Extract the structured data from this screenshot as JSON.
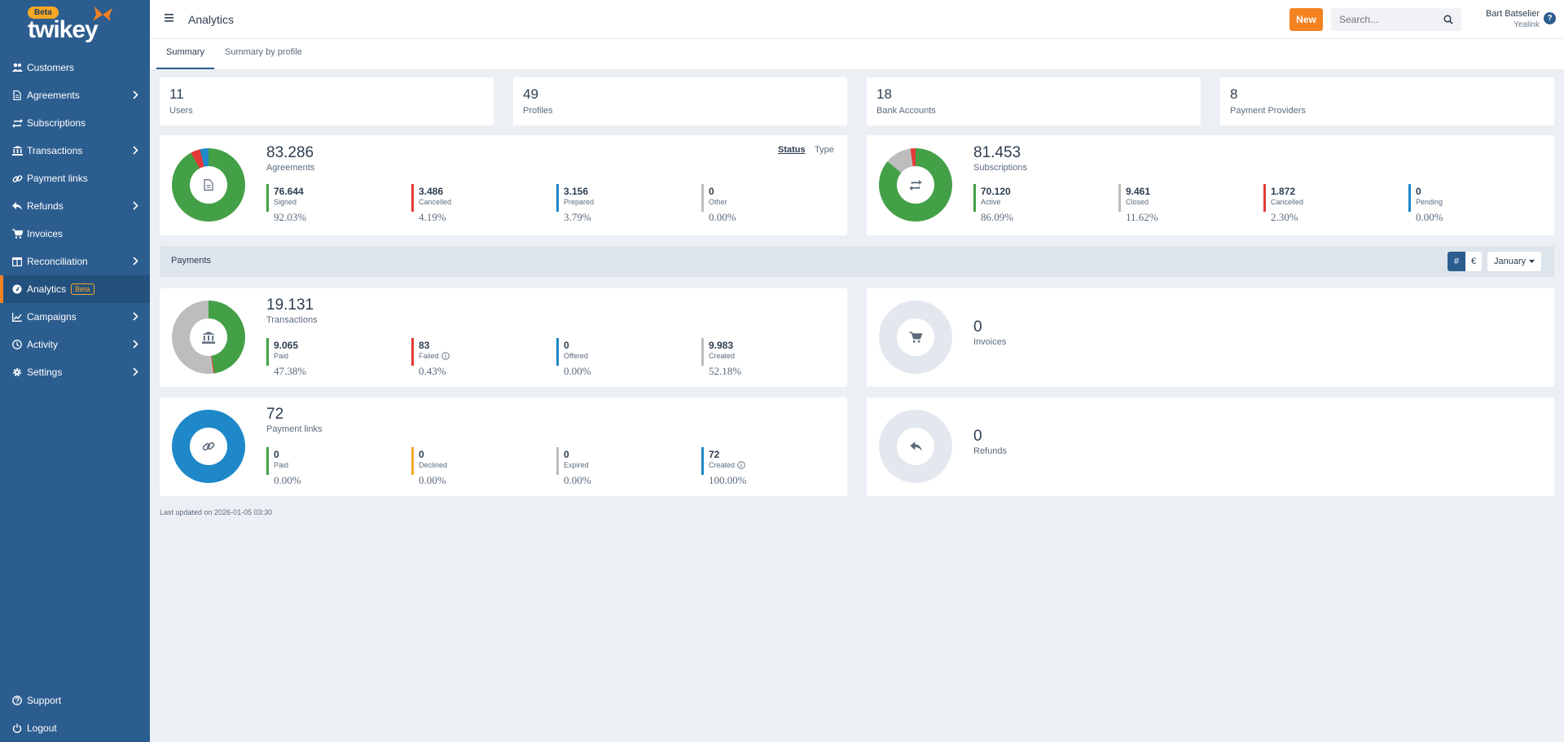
{
  "app": {
    "logo_badge": "Beta",
    "logo_word": "twikey"
  },
  "sidebar": {
    "items": [
      {
        "label": "Customers",
        "icon": "users-icon",
        "chevron": false
      },
      {
        "label": "Agreements",
        "icon": "document-icon",
        "chevron": true
      },
      {
        "label": "Subscriptions",
        "icon": "repeat-icon",
        "chevron": false
      },
      {
        "label": "Transactions",
        "icon": "bank-icon",
        "chevron": true
      },
      {
        "label": "Payment links",
        "icon": "link-icon",
        "chevron": false
      },
      {
        "label": "Refunds",
        "icon": "reply-icon",
        "chevron": true
      },
      {
        "label": "Invoices",
        "icon": "cart-icon",
        "chevron": false
      },
      {
        "label": "Reconciliation",
        "icon": "columns-icon",
        "chevron": true
      },
      {
        "label": "Analytics",
        "icon": "gauge-icon",
        "chevron": false,
        "badge": "Beta"
      },
      {
        "label": "Campaigns",
        "icon": "chart-icon",
        "chevron": true
      },
      {
        "label": "Activity",
        "icon": "clock-icon",
        "chevron": true
      },
      {
        "label": "Settings",
        "icon": "gear-icon",
        "chevron": true
      }
    ],
    "bottom": [
      {
        "label": "Support",
        "icon": "help-circle-icon"
      },
      {
        "label": "Logout",
        "icon": "power-icon"
      }
    ]
  },
  "header": {
    "title": "Analytics",
    "new_label": "New",
    "search_placeholder": "Search...",
    "user_name": "Bart Batselier",
    "user_org": "Yealink",
    "help_label": "?"
  },
  "tabs": [
    {
      "label": "Summary",
      "active": true
    },
    {
      "label": "Summary by profile",
      "active": false
    }
  ],
  "stats": [
    {
      "value": "11",
      "label": "Users"
    },
    {
      "value": "49",
      "label": "Profiles"
    },
    {
      "value": "18",
      "label": "Bank Accounts"
    },
    {
      "value": "8",
      "label": "Payment Providers"
    }
  ],
  "agreements": {
    "total": "83.286",
    "label": "Agreements",
    "toggle": [
      "Status",
      "Type"
    ],
    "metrics": [
      {
        "value": "76.644",
        "label": "Signed",
        "pct": "92.03%",
        "color": "#43a047"
      },
      {
        "value": "3.486",
        "label": "Cancelled",
        "pct": "4.19%",
        "color": "#e53935"
      },
      {
        "value": "3.156",
        "label": "Prepared",
        "pct": "3.79%",
        "color": "#1e88c8"
      },
      {
        "value": "0",
        "label": "Other",
        "pct": "0.00%",
        "color": "#bdbdbd"
      }
    ]
  },
  "subscriptions": {
    "total": "81.453",
    "label": "Subscriptions",
    "metrics": [
      {
        "value": "70.120",
        "label": "Active",
        "pct": "86.09%",
        "color": "#43a047"
      },
      {
        "value": "9.461",
        "label": "Closed",
        "pct": "11.62%",
        "color": "#bdbdbd"
      },
      {
        "value": "1.872",
        "label": "Cancelled",
        "pct": "2.30%",
        "color": "#e53935"
      },
      {
        "value": "0",
        "label": "Pending",
        "pct": "0.00%",
        "color": "#1e88c8"
      }
    ]
  },
  "payments": {
    "title": "Payments",
    "hash_label": "#",
    "euro_label": "€",
    "month": "January"
  },
  "transactions": {
    "total": "19.131",
    "label": "Transactions",
    "metrics": [
      {
        "value": "9.065",
        "label": "Paid",
        "pct": "47.38%",
        "color": "#43a047"
      },
      {
        "value": "83",
        "label": "Failed",
        "pct": "0.43%",
        "color": "#e53935",
        "info": true
      },
      {
        "value": "0",
        "label": "Offered",
        "pct": "0.00%",
        "color": "#1e88c8"
      },
      {
        "value": "9.983",
        "label": "Created",
        "pct": "52.18%",
        "color": "#bdbdbd"
      }
    ]
  },
  "invoices": {
    "total": "0",
    "label": "Invoices"
  },
  "payment_links": {
    "total": "72",
    "label": "Payment links",
    "metrics": [
      {
        "value": "0",
        "label": "Paid",
        "pct": "0.00%",
        "color": "#43a047"
      },
      {
        "value": "0",
        "label": "Declined",
        "pct": "0.00%",
        "color": "#f5a623"
      },
      {
        "value": "0",
        "label": "Expired",
        "pct": "0.00%",
        "color": "#bdbdbd"
      },
      {
        "value": "72",
        "label": "Created",
        "pct": "100.00%",
        "color": "#1e88c8",
        "info": true
      }
    ]
  },
  "refunds": {
    "total": "0",
    "label": "Refunds"
  },
  "footer": {
    "last_updated": "Last updated on 2026-01-05 03:30"
  },
  "colors": {
    "sidebar": "#2c5d8f",
    "accent": "#f48221",
    "green": "#43a047",
    "red": "#e53935",
    "blue": "#1e88c8",
    "grey": "#bdbdbd"
  }
}
